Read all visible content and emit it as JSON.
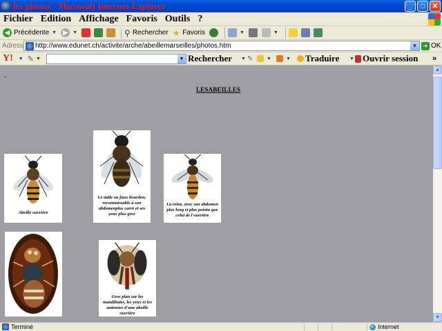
{
  "window": {
    "title": "les photos - Microsoft Internet Explorer",
    "buttons": {
      "minimize": "_",
      "maximize": "□",
      "close": "✕"
    }
  },
  "menu": [
    "Fichier",
    "Edition",
    "Affichage",
    "Favoris",
    "Outils",
    "?"
  ],
  "toolbar": {
    "back": "Précédente",
    "search": "Rechercher",
    "favorites": "Favoris"
  },
  "address": {
    "label": "Adresse",
    "url": "http://www.edunet.ch/activite/arche/abeillemarseilles/photos.htm",
    "go": "OK"
  },
  "yahoo": {
    "logo": "Y!",
    "search_button": "Rechercher",
    "translate": "Traduire",
    "session": "Ouvrir session",
    "more": "»"
  },
  "page": {
    "dot": "-",
    "heading": "LESABEILLES",
    "photos": [
      {
        "caption": "Abeille ouvrière"
      },
      {
        "caption": "Le mâle ou faux bourdon, reconnaissable à son abdomenplus carré et ses yeux plus gros"
      },
      {
        "caption": "La reine, avec son abdomen plus long et plus pointu que celui de l'ouvrière"
      },
      {
        "caption": ""
      },
      {
        "caption": "Gros plan sur les mandibules, les yeux et les antennes d'une abeille ouvrière"
      }
    ]
  },
  "status": {
    "text": "Terminé",
    "zone": "Internet"
  },
  "colors": {
    "titlebar": "#0046d5",
    "title_text": "#d8231d",
    "page_bg": "#9f9ea4"
  }
}
